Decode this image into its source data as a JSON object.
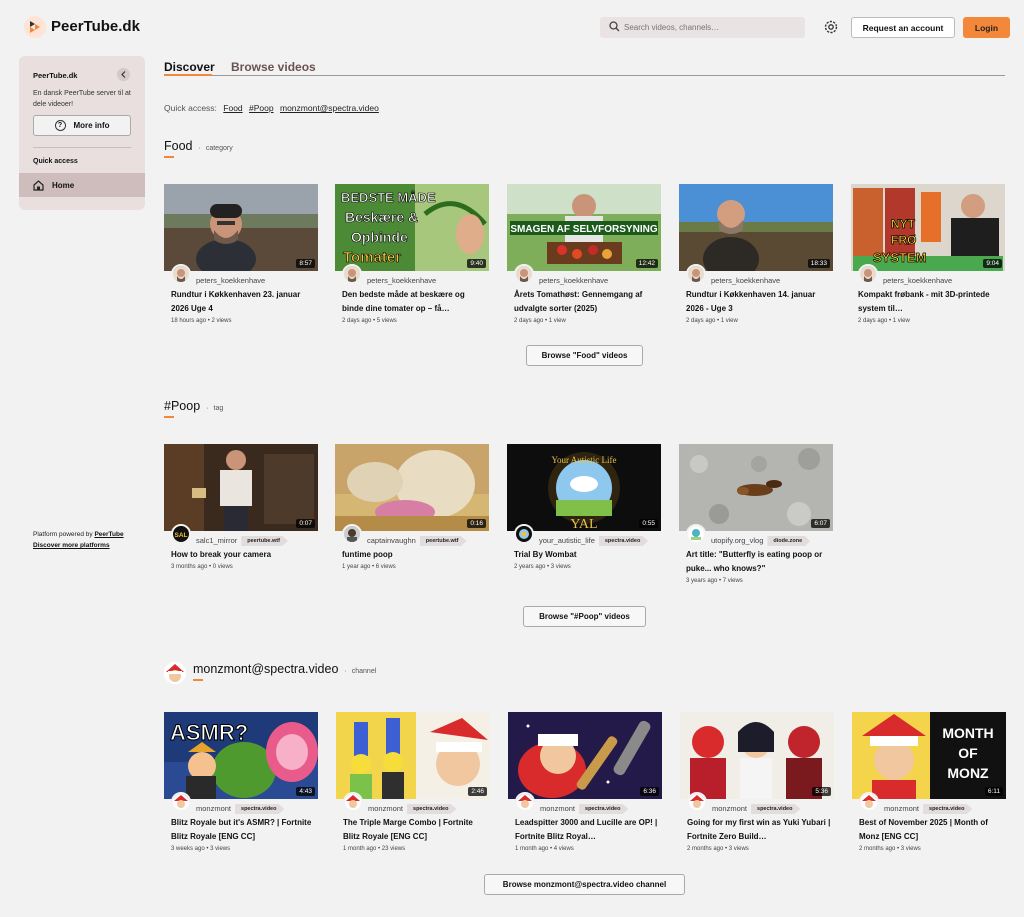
{
  "header": {
    "site_name": "PeerTube.dk",
    "search_placeholder": "Search videos, channels…",
    "request_account": "Request an account",
    "login": "Login"
  },
  "sidebar": {
    "title": "PeerTube.dk",
    "description": "En dansk PeerTube server til at dele videoer!",
    "more_info": "More info",
    "quick_access": "Quick access",
    "home": "Home",
    "powered_by": "Platform powered by",
    "powered_link": "PeerTube",
    "discover_platforms": "Discover more platforms"
  },
  "tabs": {
    "discover": "Discover",
    "browse": "Browse videos"
  },
  "quick_access": {
    "label": "Quick access:",
    "links": [
      "Food",
      "#Poop",
      "monzmont@spectra.video"
    ]
  },
  "sections": [
    {
      "title": "Food",
      "type": "category",
      "browse": "Browse \"Food\" videos",
      "videos": [
        {
          "channel": "peters_koekkenhave",
          "host": "",
          "title": "Rundtur i Køkkenhaven 23. januar 2026 Uge 4",
          "meta": "18 hours ago • 2 views",
          "duration": "8:57"
        },
        {
          "channel": "peters_koekkenhave",
          "host": "",
          "title": "Den bedste måde at beskære og binde dine tomater op – få…",
          "meta": "2 days ago • 5 views",
          "duration": "9:40"
        },
        {
          "channel": "peters_koekkenhave",
          "host": "",
          "title": "Årets Tomathøst: Gennemgang af udvalgte sorter (2025)",
          "meta": "2 days ago • 1 view",
          "duration": "12:42"
        },
        {
          "channel": "peters_koekkenhave",
          "host": "",
          "title": "Rundtur i Køkkenhaven 14. januar 2026 - Uge 3",
          "meta": "2 days ago • 1 view",
          "duration": "18:33"
        },
        {
          "channel": "peters_koekkenhave",
          "host": "",
          "title": "Kompakt frøbank - mit 3D-printede system til…",
          "meta": "2 days ago • 1 view",
          "duration": "9:04"
        }
      ]
    },
    {
      "title": "#Poop",
      "type": "tag",
      "browse": "Browse \"#Poop\" videos",
      "videos": [
        {
          "channel": "salc1_mirror",
          "host": "peertube.wtf",
          "title": "How to break your camera",
          "meta": "3 months ago • 0 views",
          "duration": "0:07"
        },
        {
          "channel": "captainvaughn",
          "host": "peertube.wtf",
          "title": "funtime poop",
          "meta": "1 year ago • 6 views",
          "duration": "0:16"
        },
        {
          "channel": "your_autistic_life",
          "host": "spectra.video",
          "title": "Trial By Wombat",
          "meta": "2 years ago • 3 views",
          "duration": "0:55"
        },
        {
          "channel": "utopify.org_vlog",
          "host": "diode.zone",
          "title": "Art title: \"Butterfly is eating poop or puke... who knows?\"",
          "meta": "3 years ago • 7 views",
          "duration": "6:07"
        }
      ]
    },
    {
      "title": "monzmont@spectra.video",
      "type": "channel",
      "browse": "Browse monzmont@spectra.video channel",
      "videos": [
        {
          "channel": "monzmont",
          "host": "spectra.video",
          "title": "Blitz Royale but it's ASMR? | Fortnite Blitz Royale [ENG CC]",
          "meta": "3 weeks ago • 3 views",
          "duration": "4:43"
        },
        {
          "channel": "monzmont",
          "host": "spectra.video",
          "title": "The Triple Marge Combo | Fortnite Blitz Royale [ENG CC]",
          "meta": "1 month ago • 23 views",
          "duration": "2:46"
        },
        {
          "channel": "monzmont",
          "host": "spectra.video",
          "title": "Leadspitter 3000 and Lucille are OP! | Fortnite Blitz Royal…",
          "meta": "1 month ago • 4 views",
          "duration": "6:36"
        },
        {
          "channel": "monzmont",
          "host": "spectra.video",
          "title": "Going for my first win as Yuki Yubari | Fortnite Zero Build…",
          "meta": "2 months ago • 3 views",
          "duration": "5:36"
        },
        {
          "channel": "monzmont",
          "host": "spectra.video",
          "title": "Best of November 2025 | Month of Monz [ENG CC]",
          "meta": "2 months ago • 3 views",
          "duration": "6:11"
        }
      ]
    }
  ],
  "thumb_text": {
    "food2_line1": "BEDSTE MÅDE",
    "food2_line2": "Beskære &",
    "food2_line3": "Opbinde",
    "food2_line4": "Tomater",
    "food3_banner": "SMAGEN AF SELVFORSYNING",
    "food5_line1": "NYT",
    "food5_line2": "FRØ",
    "food5_line3": "SYSTEM",
    "poop3_logo": "YAL",
    "poop3_arc": "Your Autistic Life",
    "monz1_text": "ASMR?",
    "monz5_line1": "MONTH",
    "monz5_line2": "OF",
    "monz5_line3": "MONZ",
    "avatar_salc": "SAL"
  },
  "colors": {
    "accent": "#f3883a",
    "sidebar_bg": "#e9dfdf",
    "sidebar_active": "#cfbdbd"
  }
}
